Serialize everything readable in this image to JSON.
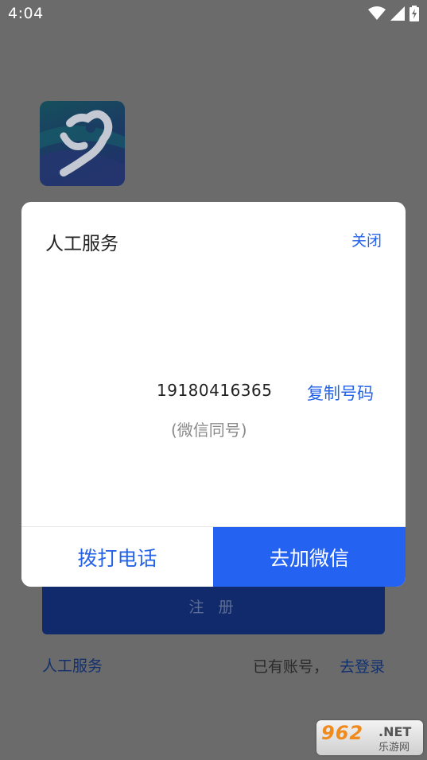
{
  "status_bar": {
    "time": "4:04"
  },
  "app": {
    "register_label": "注 册",
    "manual_service_label": "人工服务",
    "login_prompt": "已有账号，",
    "login_link": "去登录"
  },
  "dialog": {
    "title": "人工服务",
    "close_label": "关闭",
    "phone_number": "19180416365",
    "copy_label": "复制号码",
    "wechat_note": "(微信同号)",
    "call_button": "拨打电话",
    "wechat_button": "去加微信"
  },
  "watermark": {
    "main": "962",
    "net": ".NET",
    "sub": "乐游网"
  },
  "colors": {
    "accent": "#2563e8",
    "primary_button": "#2462f2",
    "overlay": "#6b6b6b"
  }
}
